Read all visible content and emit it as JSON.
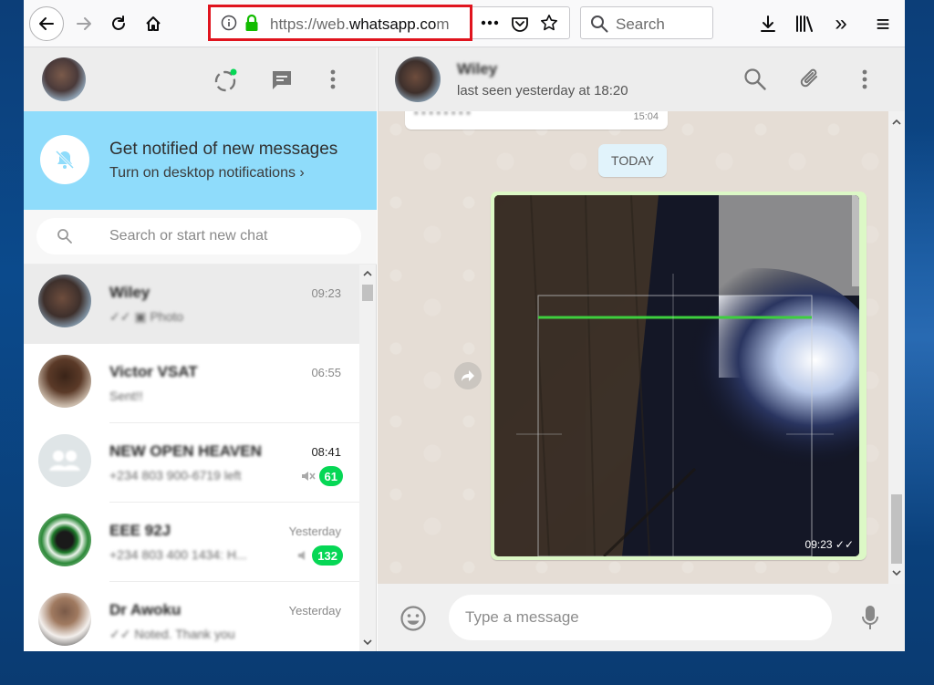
{
  "browser": {
    "url_prefix": "https://web.",
    "url_domain": "whatsapp.co",
    "url_suffix": "m",
    "search_placeholder": "Search",
    "overflow_label": "»",
    "menu_label": "≡"
  },
  "sidebar": {
    "notification": {
      "title": "Get notified of new messages",
      "subtitle": "Turn on desktop notifications ›"
    },
    "search_placeholder": "Search or start new chat",
    "chats": [
      {
        "name": "Wiley",
        "last": "✓✓ ▣ Photo",
        "time": "09:23"
      },
      {
        "name": "Victor VSAT",
        "last": "Sent!!",
        "time": "06:55"
      },
      {
        "name": "NEW OPEN HEAVEN",
        "last": "+234 803 900-6719 left",
        "time": "08:41",
        "badge": "61"
      },
      {
        "name": "EEE 92J",
        "last": "+234 803 400 1434: H...",
        "time": "Yesterday",
        "badge": "132"
      },
      {
        "name": "Dr Awoku",
        "last": "✓✓ Noted. Thank you",
        "time": "Yesterday"
      }
    ]
  },
  "conversation": {
    "contact_name": "Wiley",
    "contact_status": "last seen yesterday at 18:20",
    "prev_message": "• • • • • • • •",
    "prev_time": "15:04",
    "date_chip": "TODAY",
    "photo_time": "09:23",
    "photo_ticks": "✓✓",
    "composer_placeholder": "Type a message"
  },
  "colors": {
    "notification_bg": "#8fdcfb",
    "badge_green": "#06d755",
    "outgoing_bubble": "#dcf8c6",
    "chat_wallpaper": "#e5ddd5",
    "url_highlight": "#e0141e",
    "lock_green": "#12bc00"
  }
}
